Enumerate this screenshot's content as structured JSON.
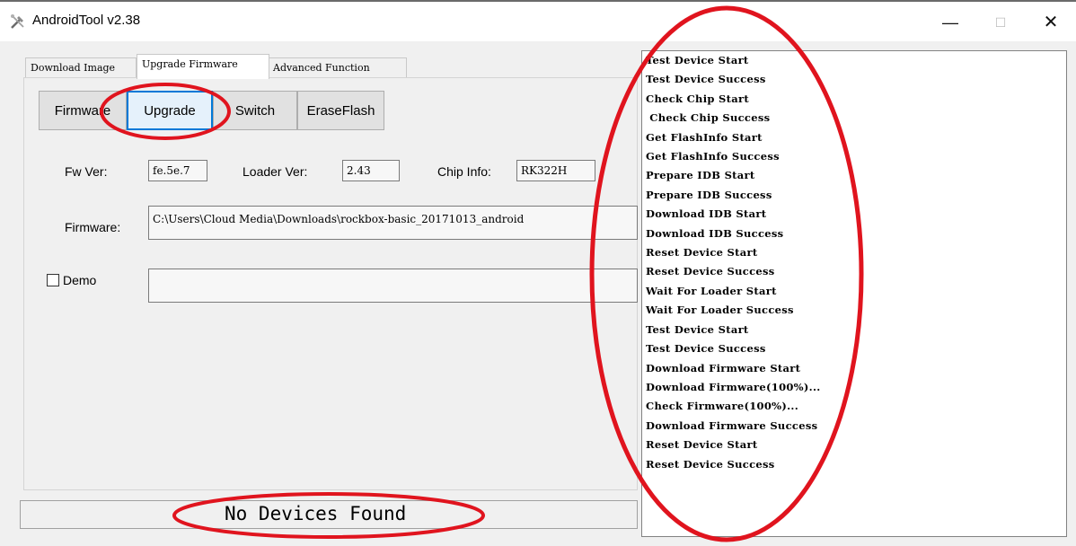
{
  "window": {
    "title": "AndroidTool v2.38",
    "icons": {
      "app": "tools-icon",
      "minimize": "minimize-icon",
      "maximize": "maximize-icon",
      "close": "close-icon"
    },
    "minimize_glyph": "—",
    "maximize_glyph": "☐",
    "close_glyph": "✕"
  },
  "tabs": [
    {
      "label": "Download Image"
    },
    {
      "label": "Upgrade Firmware"
    },
    {
      "label": "Advanced Function"
    }
  ],
  "buttons": {
    "firmware": "Firmware",
    "upgrade": "Upgrade",
    "switch": "Switch",
    "erase_flash": "EraseFlash"
  },
  "fields": {
    "fw_ver_label": "Fw Ver:",
    "fw_ver_value": "fe.5e.7",
    "loader_ver_label": "Loader Ver:",
    "loader_ver_value": "2.43",
    "chip_info_label": "Chip Info:",
    "chip_info_value": "RK322H",
    "firmware_label": "Firmware:",
    "firmware_path": "C:\\Users\\Cloud Media\\Downloads\\rockbox-basic_20171013_android",
    "demo_label": "Demo",
    "demo_value": ""
  },
  "status": {
    "text": "No Devices Found"
  },
  "log": [
    "Test Device Start",
    "Test Device Success",
    "Check Chip Start",
    " Check Chip Success",
    "Get FlashInfo Start",
    "Get FlashInfo Success",
    "Prepare IDB Start",
    "Prepare IDB Success",
    "Download IDB Start",
    "Download IDB Success",
    "Reset Device Start",
    "Reset Device Success",
    "Wait For Loader Start",
    "Wait For Loader Success",
    "Test Device Start",
    "Test Device Success",
    "Download Firmware Start",
    "Download Firmware(100%)...",
    "Check Firmware(100%)...",
    "Download Firmware Success",
    "Reset Device Start",
    "Reset Device Success"
  ],
  "colors": {
    "annotation": "#e0141e",
    "focus": "#0078d7"
  }
}
